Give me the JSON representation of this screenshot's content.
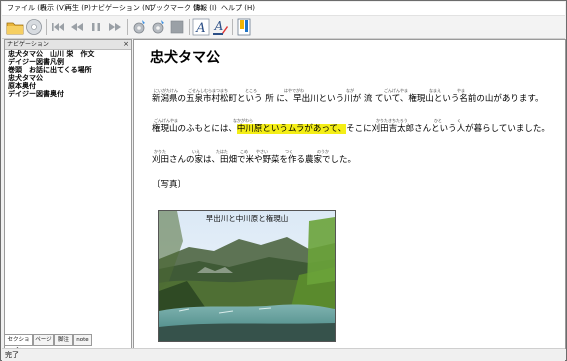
{
  "menu": {
    "items": [
      "ファイル (F)",
      "表示 (V)",
      "再生 (P)",
      "ナビゲーション (N)",
      "ブックマーク (B)",
      "情報 (I)",
      "ヘルプ (H)"
    ]
  },
  "toolbar": {
    "icons": [
      "open-folder-icon",
      "disc-icon",
      "skip-back-icon",
      "rewind-icon",
      "pause-icon",
      "fast-forward-icon",
      "settings-gear-icon",
      "refresh-gear-icon",
      "stop-square-icon",
      "font-a-icon",
      "font-color-icon",
      "bookmark-icon"
    ]
  },
  "nav": {
    "title": "ナビゲーション",
    "close": "×",
    "items": [
      "忠犬タマ公　山川 栄　作文",
      "デイジー図書凡例",
      "巻頭　お話に出てくる場所",
      "忠犬タマ公",
      "原本奥付",
      "デイジー図書奥付"
    ],
    "tabs": [
      "セクション",
      "ページ",
      "脚注",
      "note"
    ]
  },
  "doc": {
    "title": "忠犬タマ公",
    "p1": {
      "text": "新潟県の五泉市村松町という 所 に、早出川という川が 流 ていて、権現山という名前の山があります。",
      "ruby": [
        "にいがたけん",
        "ごせんしむらまつまち",
        "ところ",
        "はやでがわ",
        "なが",
        "ごんげんやま",
        "なまえ",
        "やま"
      ]
    },
    "p2": {
      "before": "権現山のふもとには、",
      "highlight": "中川原というムラがあって、",
      "after": "そこに刈田吉太郎さんという人が暮らしていました。",
      "ruby": [
        "ごんげんやま",
        "なかがわら",
        "かりたきちたろう",
        "ひと",
        "く"
      ]
    },
    "p3": {
      "text": "刈田さんの家は、田畑で米や野菜を作る農家でした。",
      "ruby": [
        "かりた",
        "いえ",
        "たはた",
        "こめ",
        "やさい",
        "つく",
        "のうか"
      ]
    },
    "photo_label": "〔写真〕",
    "photo_caption": "早出川と中川原と権現山"
  },
  "status": {
    "text": "完了"
  }
}
